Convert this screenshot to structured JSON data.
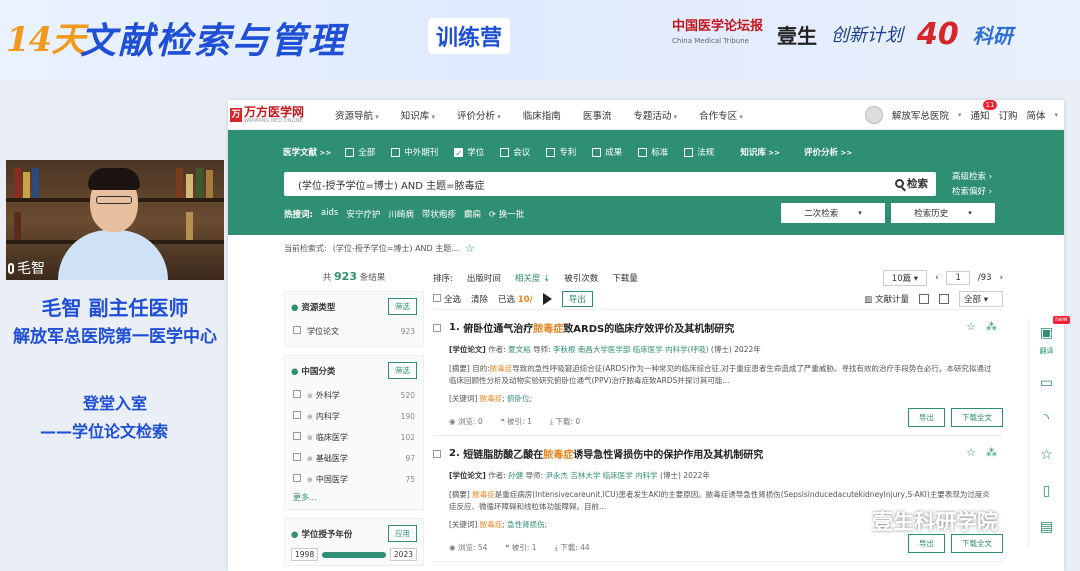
{
  "banner": {
    "days": "14天",
    "title": "文献检索与管理",
    "subtitle": "训练营",
    "logos": {
      "cmt": "中国医学论坛报",
      "cmt_en": "China Medical Tribune",
      "yisheng": "壹生",
      "chuangxin": "创新计划",
      "forty": "40",
      "keyan": "科研"
    }
  },
  "presenter": {
    "video_label": "毛智",
    "name": "毛智 副主任医师",
    "org": "解放军总医院第一医学中心",
    "topic_line1": "登堂入室",
    "topic_line2": "——学位论文检索"
  },
  "site": {
    "brand": "万方医学网",
    "brand_en": "WANFANG MED ONLINE",
    "nav": [
      "资源导航",
      "知识库",
      "评价分析",
      "临床指南",
      "医事流",
      "专题活动",
      "合作专区"
    ],
    "user": "解放军总医院",
    "notice_label": "通知",
    "notice_count": "11",
    "order_label": "订购",
    "lang_label": "简体"
  },
  "hero": {
    "filter_label": "医学文献",
    "filters": [
      {
        "label": "全部",
        "checked": false
      },
      {
        "label": "中外期刊",
        "checked": false
      },
      {
        "label": "学位",
        "checked": true
      },
      {
        "label": "会议",
        "checked": false
      },
      {
        "label": "专利",
        "checked": false
      },
      {
        "label": "成果",
        "checked": false
      },
      {
        "label": "标准",
        "checked": false
      },
      {
        "label": "法规",
        "checked": false
      }
    ],
    "tab_knowledge": "知识库",
    "tab_eval": "评价分析",
    "query": "(学位-授予学位=博士) AND 主题=脓毒症",
    "search_button": "检索",
    "adv_search": "高级检索",
    "search_pref": "检索偏好",
    "hot_label": "热搜词:",
    "hot_terms": [
      "aids",
      "安宁疗护",
      "川崎病",
      "带状疱疹",
      "癫痫"
    ],
    "refresh": "换一批",
    "secondary_search": "二次检索",
    "history": "检索历史"
  },
  "crumb": {
    "label": "当前检索式:",
    "query": "(学位-授予学位=博士) AND 主题..."
  },
  "left": {
    "total_prefix": "共",
    "total_count": "923",
    "total_suffix": "条结果",
    "groups": [
      {
        "title": "资源类型",
        "btn": "筛选",
        "items": [
          {
            "label": "学位论文",
            "count": "923"
          }
        ]
      },
      {
        "title": "中国分类",
        "btn": "筛选",
        "items": [
          {
            "label": "外科学",
            "count": "520"
          },
          {
            "label": "内科学",
            "count": "190"
          },
          {
            "label": "临床医学",
            "count": "102"
          },
          {
            "label": "基础医学",
            "count": "97"
          },
          {
            "label": "中国医学",
            "count": "75"
          }
        ],
        "more": "更多..."
      },
      {
        "title": "学位授予年份",
        "btn": "应用"
      }
    ],
    "year_from": "1998",
    "year_to": "2023"
  },
  "main": {
    "sort_label": "排序:",
    "sort_options": [
      "出版时间",
      "相关度",
      "被引次数",
      "下载量"
    ],
    "page_size": "10篇",
    "page": "1",
    "pages": "/93",
    "select_all": "全选",
    "clear": "清除",
    "selected": "已选",
    "selected_count": "10/",
    "export": "导出",
    "measure": "文献计量",
    "dropdown": "全部",
    "results": [
      {
        "n": "1.",
        "t1": "俯卧位通气治疗",
        "hl": "脓毒症",
        "t2": "致ARDS的临床疗效评价及其机制研究",
        "type": "[学位论文]",
        "author_label": "作者:",
        "author": "夏文裕",
        "mentor_label": "导师:",
        "mentor": "李秋根",
        "school": "南昌大学医学部",
        "major": "临床医学 内科学(呼吸)",
        "degree": "(博士)",
        "year": "2022年",
        "abs_label": "[摘要]",
        "abs_pre": "目的:",
        "abs_hl": "脓毒症",
        "abs": "导致的急性呼吸窘迫综合征(ARDS)作为一种常见的临床综合征,对于重症患者生命造成了严重威胁。寻找有效的治疗手段势在必行。本研究拟通过临床回顾性分析及动物实验研究俯卧位通气(PPV)治疗脓毒症致ARDS并探讨其可能...",
        "kw_label": "[关键词]",
        "kw": [
          "脓毒症",
          "俯卧位"
        ],
        "views": "浏览: 0",
        "cites": "被引: 1",
        "dl": "下载: 0",
        "btn_export": "导出",
        "btn_download": "下载全文"
      },
      {
        "n": "2.",
        "t1": "短链脂肪酸乙酸在",
        "hl": "脓毒症",
        "t2": "诱导急性肾损伤中的保护作用及其机制研究",
        "type": "[学位论文]",
        "author_label": "作者:",
        "author": "孙健",
        "mentor_label": "导师:",
        "mentor": "尹永杰",
        "school": "吉林大学",
        "major": "临床医学 内科学",
        "degree": "(博士)",
        "year": "2022年",
        "abs_label": "[摘要]",
        "abs_pre": "",
        "abs_hl": "脓毒症",
        "abs": "是重症病房(Intensivecareunit,ICU)患者发生AKI的主要原因。脓毒症诱导急性肾损伤(SepsisinducedacutekidneyInjury,S-AKI)主要表现为过度炎症反应、微循环障碍和线粒体功能障碍。目前...",
        "kw_label": "[关键词]",
        "kw": [
          "脓毒症",
          "急性肾损伤"
        ],
        "views": "浏览: 54",
        "cites": "被引: 1",
        "dl": "下载: 44",
        "btn_export": "导出",
        "btn_download": "下载全文"
      }
    ]
  },
  "dock": {
    "new_tag": "new",
    "translate": "翻译"
  },
  "watermark": "壹生科研学院"
}
